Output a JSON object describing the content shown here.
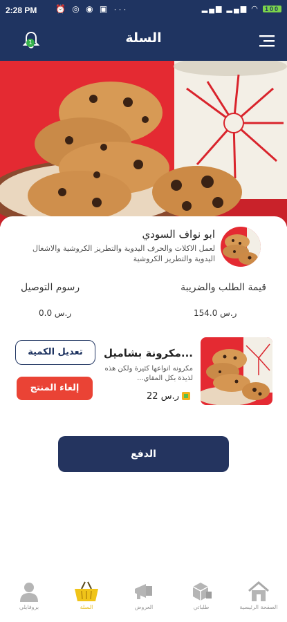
{
  "status_bar": {
    "time": "2:28 PM",
    "battery": "100"
  },
  "app_bar": {
    "title": "السلة",
    "notification_count": "1"
  },
  "store": {
    "name": "ابو نواف السودي",
    "description": "لعمل الاكلات والحرف اليدوية والتطريز الكروشية والاشغال اليدوية والتطريز الكروشية"
  },
  "summary": {
    "order_total_label": "قيمة الطلب والضريبة",
    "order_total_value": "154.0 ر.س",
    "delivery_label": "رسوم التوصيل",
    "delivery_value": "0.0 ر.س"
  },
  "product": {
    "name": "مكرونة بشاميل...",
    "description": "مكرونه انواعها كثيرة ولكن هذه لذيذة بكل المقاي...",
    "price": "22 ر.س",
    "edit_label": "تعديل الكمية",
    "cancel_label": "إلغاء المنتج"
  },
  "pay_label": "الدفع",
  "bottom_nav": [
    {
      "label": "الصفحة الرئيسية",
      "icon": "home-icon"
    },
    {
      "label": "طلباتي",
      "icon": "orders-icon"
    },
    {
      "label": "العروض",
      "icon": "megaphone-icon"
    },
    {
      "label": "السلة",
      "icon": "basket-icon",
      "active": true
    },
    {
      "label": "بروفايلي",
      "icon": "profile-icon"
    }
  ],
  "colors": {
    "primary": "#1f3461",
    "danger": "#ea4335",
    "active_nav": "#e8c02a",
    "badge": "#36b24a"
  }
}
